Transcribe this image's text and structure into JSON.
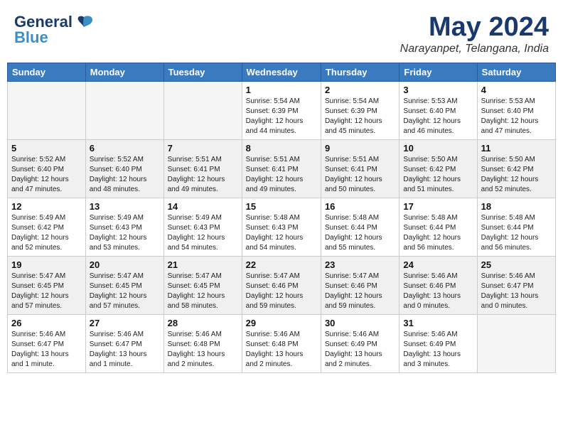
{
  "header": {
    "logo_line1": "General",
    "logo_line2": "Blue",
    "month_title": "May 2024",
    "location": "Narayanpet, Telangana, India"
  },
  "weekdays": [
    "Sunday",
    "Monday",
    "Tuesday",
    "Wednesday",
    "Thursday",
    "Friday",
    "Saturday"
  ],
  "weeks": [
    {
      "shaded": false,
      "days": [
        {
          "num": "",
          "info": ""
        },
        {
          "num": "",
          "info": ""
        },
        {
          "num": "",
          "info": ""
        },
        {
          "num": "1",
          "info": "Sunrise: 5:54 AM\nSunset: 6:39 PM\nDaylight: 12 hours\nand 44 minutes."
        },
        {
          "num": "2",
          "info": "Sunrise: 5:54 AM\nSunset: 6:39 PM\nDaylight: 12 hours\nand 45 minutes."
        },
        {
          "num": "3",
          "info": "Sunrise: 5:53 AM\nSunset: 6:40 PM\nDaylight: 12 hours\nand 46 minutes."
        },
        {
          "num": "4",
          "info": "Sunrise: 5:53 AM\nSunset: 6:40 PM\nDaylight: 12 hours\nand 47 minutes."
        }
      ]
    },
    {
      "shaded": true,
      "days": [
        {
          "num": "5",
          "info": "Sunrise: 5:52 AM\nSunset: 6:40 PM\nDaylight: 12 hours\nand 47 minutes."
        },
        {
          "num": "6",
          "info": "Sunrise: 5:52 AM\nSunset: 6:40 PM\nDaylight: 12 hours\nand 48 minutes."
        },
        {
          "num": "7",
          "info": "Sunrise: 5:51 AM\nSunset: 6:41 PM\nDaylight: 12 hours\nand 49 minutes."
        },
        {
          "num": "8",
          "info": "Sunrise: 5:51 AM\nSunset: 6:41 PM\nDaylight: 12 hours\nand 49 minutes."
        },
        {
          "num": "9",
          "info": "Sunrise: 5:51 AM\nSunset: 6:41 PM\nDaylight: 12 hours\nand 50 minutes."
        },
        {
          "num": "10",
          "info": "Sunrise: 5:50 AM\nSunset: 6:42 PM\nDaylight: 12 hours\nand 51 minutes."
        },
        {
          "num": "11",
          "info": "Sunrise: 5:50 AM\nSunset: 6:42 PM\nDaylight: 12 hours\nand 52 minutes."
        }
      ]
    },
    {
      "shaded": false,
      "days": [
        {
          "num": "12",
          "info": "Sunrise: 5:49 AM\nSunset: 6:42 PM\nDaylight: 12 hours\nand 52 minutes."
        },
        {
          "num": "13",
          "info": "Sunrise: 5:49 AM\nSunset: 6:43 PM\nDaylight: 12 hours\nand 53 minutes."
        },
        {
          "num": "14",
          "info": "Sunrise: 5:49 AM\nSunset: 6:43 PM\nDaylight: 12 hours\nand 54 minutes."
        },
        {
          "num": "15",
          "info": "Sunrise: 5:48 AM\nSunset: 6:43 PM\nDaylight: 12 hours\nand 54 minutes."
        },
        {
          "num": "16",
          "info": "Sunrise: 5:48 AM\nSunset: 6:44 PM\nDaylight: 12 hours\nand 55 minutes."
        },
        {
          "num": "17",
          "info": "Sunrise: 5:48 AM\nSunset: 6:44 PM\nDaylight: 12 hours\nand 56 minutes."
        },
        {
          "num": "18",
          "info": "Sunrise: 5:48 AM\nSunset: 6:44 PM\nDaylight: 12 hours\nand 56 minutes."
        }
      ]
    },
    {
      "shaded": true,
      "days": [
        {
          "num": "19",
          "info": "Sunrise: 5:47 AM\nSunset: 6:45 PM\nDaylight: 12 hours\nand 57 minutes."
        },
        {
          "num": "20",
          "info": "Sunrise: 5:47 AM\nSunset: 6:45 PM\nDaylight: 12 hours\nand 57 minutes."
        },
        {
          "num": "21",
          "info": "Sunrise: 5:47 AM\nSunset: 6:45 PM\nDaylight: 12 hours\nand 58 minutes."
        },
        {
          "num": "22",
          "info": "Sunrise: 5:47 AM\nSunset: 6:46 PM\nDaylight: 12 hours\nand 59 minutes."
        },
        {
          "num": "23",
          "info": "Sunrise: 5:47 AM\nSunset: 6:46 PM\nDaylight: 12 hours\nand 59 minutes."
        },
        {
          "num": "24",
          "info": "Sunrise: 5:46 AM\nSunset: 6:46 PM\nDaylight: 13 hours\nand 0 minutes."
        },
        {
          "num": "25",
          "info": "Sunrise: 5:46 AM\nSunset: 6:47 PM\nDaylight: 13 hours\nand 0 minutes."
        }
      ]
    },
    {
      "shaded": false,
      "days": [
        {
          "num": "26",
          "info": "Sunrise: 5:46 AM\nSunset: 6:47 PM\nDaylight: 13 hours\nand 1 minute."
        },
        {
          "num": "27",
          "info": "Sunrise: 5:46 AM\nSunset: 6:47 PM\nDaylight: 13 hours\nand 1 minute."
        },
        {
          "num": "28",
          "info": "Sunrise: 5:46 AM\nSunset: 6:48 PM\nDaylight: 13 hours\nand 2 minutes."
        },
        {
          "num": "29",
          "info": "Sunrise: 5:46 AM\nSunset: 6:48 PM\nDaylight: 13 hours\nand 2 minutes."
        },
        {
          "num": "30",
          "info": "Sunrise: 5:46 AM\nSunset: 6:49 PM\nDaylight: 13 hours\nand 2 minutes."
        },
        {
          "num": "31",
          "info": "Sunrise: 5:46 AM\nSunset: 6:49 PM\nDaylight: 13 hours\nand 3 minutes."
        },
        {
          "num": "",
          "info": ""
        }
      ]
    }
  ]
}
